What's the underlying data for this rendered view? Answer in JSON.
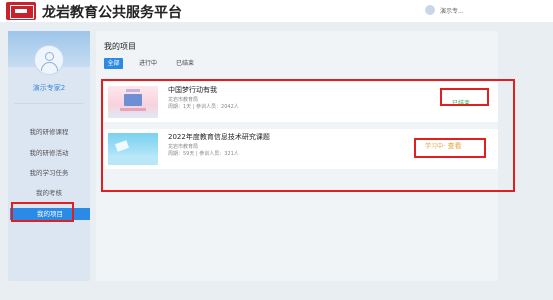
{
  "header": {
    "site_title": "龙岩教育公共服务平台",
    "user_name": "演示专..."
  },
  "sidebar": {
    "expert_name": "演示专家2",
    "items": [
      {
        "label": "我的研修课程"
      },
      {
        "label": "我的研修活动"
      },
      {
        "label": "我的学习任务"
      },
      {
        "label": "我的考核"
      },
      {
        "label": "我的项目"
      }
    ]
  },
  "main": {
    "page_title": "我的项目",
    "tabs": [
      {
        "label": "全部"
      },
      {
        "label": "进行中"
      },
      {
        "label": "已结束"
      }
    ],
    "projects": [
      {
        "title": "中国梦行动有我",
        "org": "龙岩市教育局",
        "meta": "周期：1天 | 参训人员：2042人",
        "status": "已结束"
      },
      {
        "title": "2022年度教育信息技术研究课题",
        "org": "龙岩市教育局",
        "meta": "周期：59天 | 参训人员：321人",
        "status": "学习中",
        "action": "· 查看"
      }
    ]
  },
  "colors": {
    "accent": "#2b8ae6",
    "annotation": "#e02020",
    "status_ended": "#3aa64a",
    "status_progress": "#e8a23a"
  }
}
